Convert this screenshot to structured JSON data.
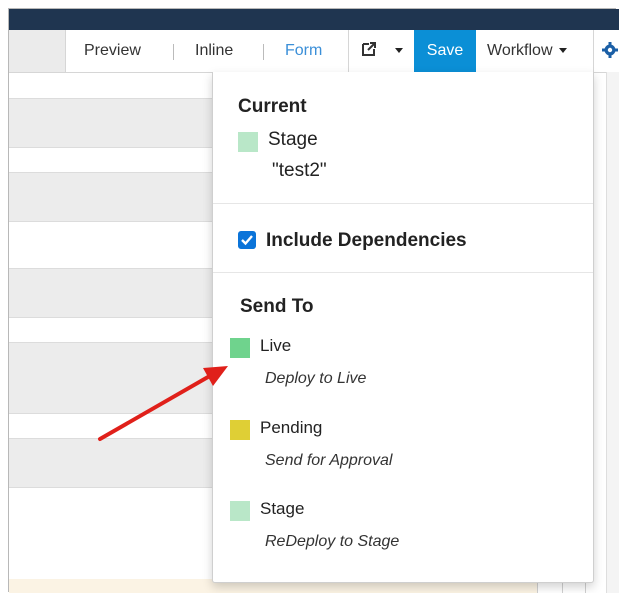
{
  "toolbar": {
    "preview": "Preview",
    "inline": "Inline",
    "form": "Form",
    "save": "Save",
    "workflow": "Workflow"
  },
  "dropdown": {
    "current_heading": "Current",
    "current_stage_label": "Stage",
    "current_stage_value": "\"test2\"",
    "include_dependencies": "Include Dependencies",
    "include_dependencies_checked": true,
    "send_to_heading": "Send To",
    "targets": [
      {
        "label": "Live",
        "description": "Deploy to Live",
        "color": "#6fd38d"
      },
      {
        "label": "Pending",
        "description": "Send for Approval",
        "color": "#dfcf35"
      },
      {
        "label": "Stage",
        "description": "ReDeploy to Stage",
        "color": "#b9e7c8"
      }
    ],
    "current_stage_color": "#b9e7c8"
  },
  "colors": {
    "topbar": "#1f3550",
    "save_button": "#0b8fd6",
    "form_link": "#3b8fd8",
    "arrow": "#e0201a"
  }
}
